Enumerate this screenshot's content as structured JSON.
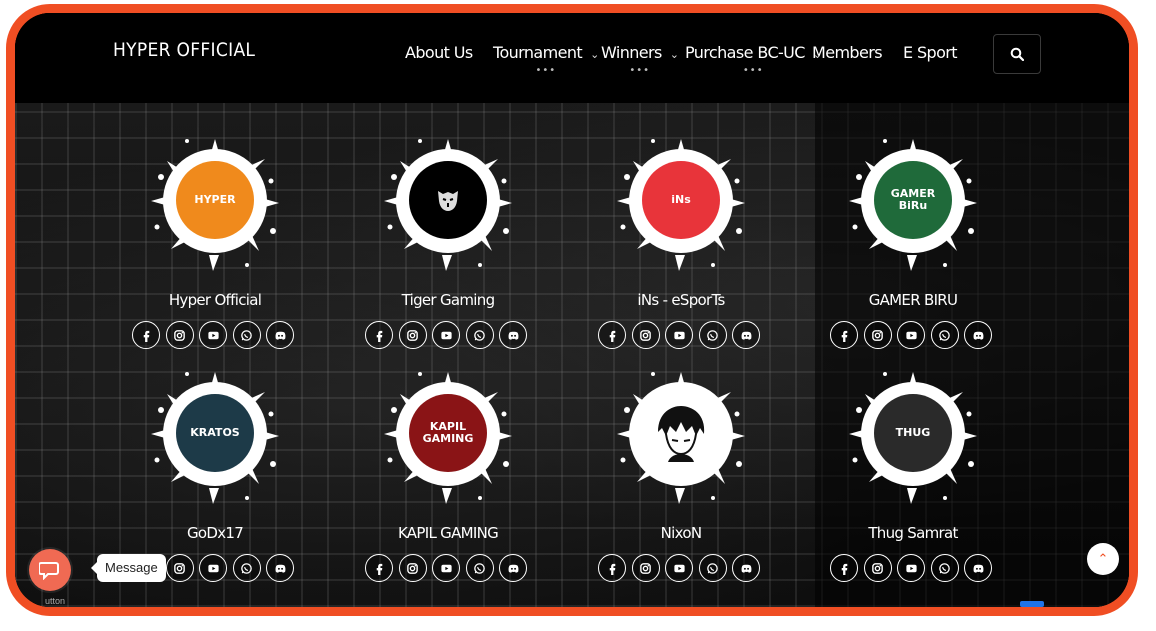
{
  "brand": {
    "name": "HYPER OFFICIAL"
  },
  "nav": [
    {
      "label": "About Us",
      "has_dropdown": false,
      "dots": ""
    },
    {
      "label": "Tournament",
      "has_dropdown": true,
      "dots": "•••"
    },
    {
      "label": "Winners",
      "has_dropdown": true,
      "dots": "•••"
    },
    {
      "label": "Purchase BC-UC",
      "has_dropdown": true,
      "dots": "•••"
    },
    {
      "label": "Members",
      "has_dropdown": false,
      "dots": ""
    },
    {
      "label": "E Sport",
      "has_dropdown": false,
      "dots": ""
    }
  ],
  "teams": [
    {
      "name": "Hyper Official",
      "avatar_icon": "hyper-logo-icon",
      "avatar_color": "#f08a1c",
      "avatar_text": "HYPER"
    },
    {
      "name": "Tiger Gaming",
      "avatar_icon": "tiger-logo-icon",
      "avatar_color": "#000000",
      "avatar_text": ""
    },
    {
      "name": "iNs - eSporTs",
      "avatar_icon": "lion-logo-icon",
      "avatar_color": "#e8343a",
      "avatar_text": "iNs"
    },
    {
      "name": "GAMER BIRU",
      "avatar_icon": "gamer-biru-logo-icon",
      "avatar_color": "#1f6a3a",
      "avatar_text": "GAMER BiRu"
    },
    {
      "name": "GoDx17",
      "avatar_icon": "kratos-logo-icon",
      "avatar_color": "#1d3a48",
      "avatar_text": "KRATOS"
    },
    {
      "name": "KAPIL GAMING",
      "avatar_icon": "kapil-logo-icon",
      "avatar_color": "#8a1416",
      "avatar_text": "KAPIL GAMING"
    },
    {
      "name": "NixoN",
      "avatar_icon": "anime-boy-logo-icon",
      "avatar_color": "#ffffff",
      "avatar_text": ""
    },
    {
      "name": "Thug Samrat",
      "avatar_icon": "hooded-figure-logo-icon",
      "avatar_color": "#2a2a2a",
      "avatar_text": "THUG"
    }
  ],
  "social_icons": [
    "facebook-icon",
    "instagram-icon",
    "youtube-icon",
    "whatsapp-icon",
    "discord-icon"
  ],
  "chat": {
    "label": "Message",
    "sub": "utton"
  },
  "colors": {
    "accent": "#f04e23",
    "chat": "#f06a53"
  }
}
